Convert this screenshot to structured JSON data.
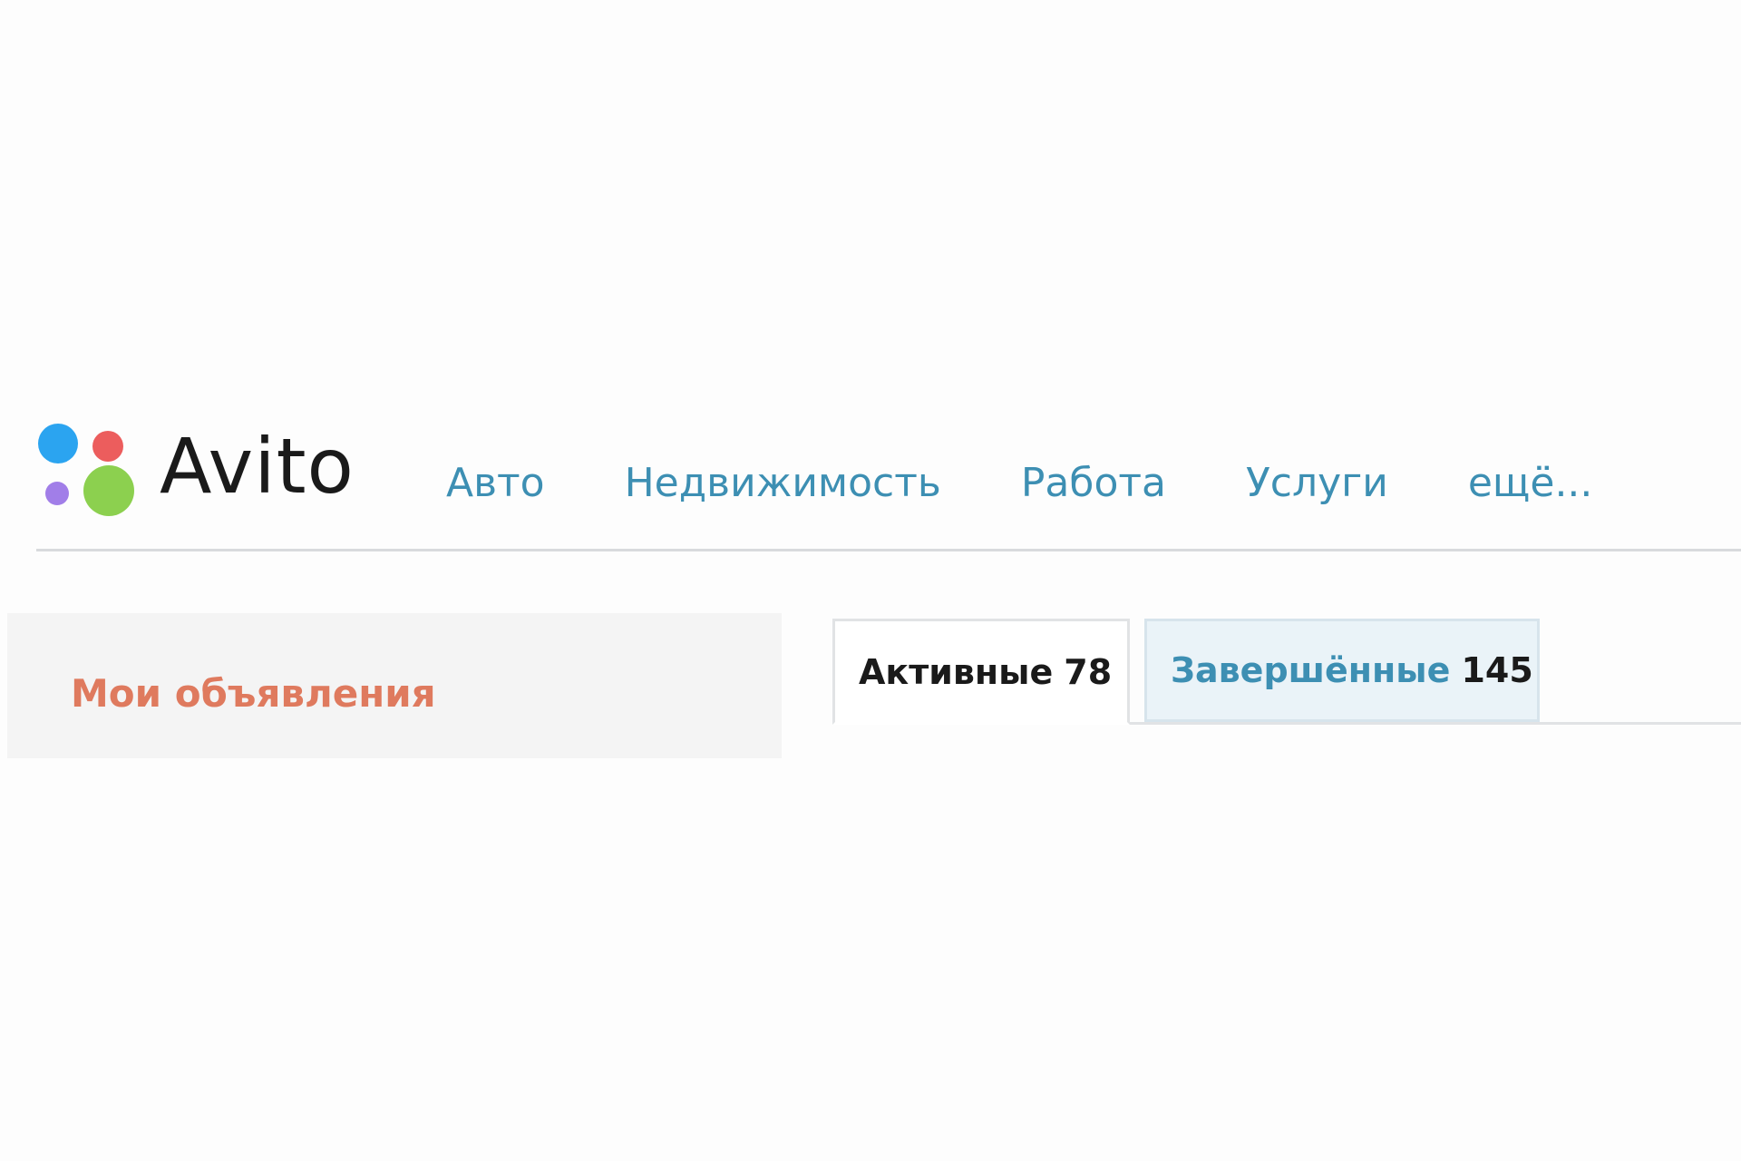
{
  "colors": {
    "page_bg": "#fdfdfd",
    "link_blue": "#3d8fb3",
    "sidebar_title": "#df7a5e",
    "text_dark": "#1a1a1a",
    "logo_blue": "#2ba4f0",
    "logo_red": "#ec5d5d",
    "logo_purple": "#a17ee8",
    "logo_green": "#8cd04f"
  },
  "header": {
    "logo": {
      "text": "Avito",
      "icon": "avito-dots-logo-icon"
    },
    "nav": [
      {
        "label": "Авто"
      },
      {
        "label": "Недвижимость"
      },
      {
        "label": "Работа"
      },
      {
        "label": "Услуги"
      },
      {
        "label": "ещё..."
      }
    ]
  },
  "sidebar": {
    "title": "Мои объявления"
  },
  "tabs": [
    {
      "label": "Активные",
      "count": "78",
      "active": true
    },
    {
      "label": "Завершённые",
      "count": "145",
      "active": false
    }
  ]
}
